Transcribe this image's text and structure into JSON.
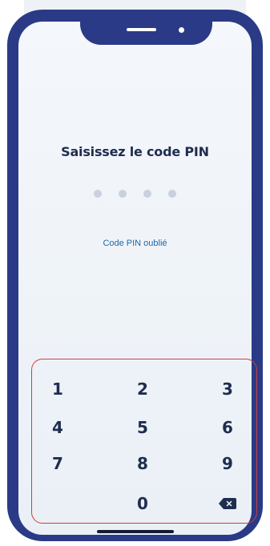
{
  "pin_screen": {
    "title": "Saisissez le code PIN",
    "pin_length": 4,
    "pin_filled": 0,
    "forgot_link": "Code PIN oublié"
  },
  "keypad": {
    "keys": [
      "1",
      "2",
      "3",
      "4",
      "5",
      "6",
      "7",
      "8",
      "9",
      "0"
    ],
    "backspace_icon": "backspace-icon"
  },
  "colors": {
    "device_frame": "#2b3a86",
    "text_primary": "#1f2d4f",
    "link": "#1e67a8",
    "pin_dot_empty": "#c9d1dc",
    "highlight_outline": "#c9413c"
  }
}
